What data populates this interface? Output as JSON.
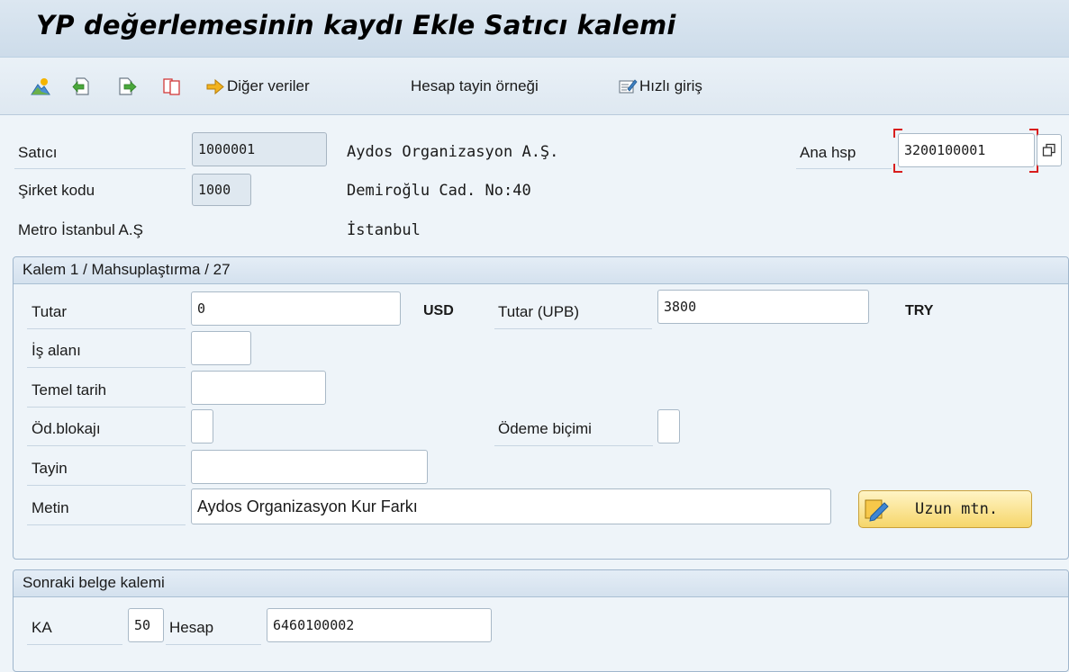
{
  "title": "YP değerlemesinin kaydı Ekle Satıcı kalemi",
  "toolbar": {
    "other_data": "Diğer veriler",
    "account_model": "Hesap tayin örneği",
    "quick_entry": "Hızlı giriş"
  },
  "header": {
    "vendor_label": "Satıcı",
    "vendor_value": "1000001",
    "vendor_name": "Aydos Organizasyon A.Ş.",
    "company_label": "Şirket kodu",
    "company_value": "1000",
    "vendor_street": "Demiroğlu Cad. No:40",
    "company_name": "Metro İstanbul A.Ş",
    "vendor_city": "İstanbul",
    "gl_label": "Ana hsp",
    "gl_value": "3200100001"
  },
  "item": {
    "group_title": "Kalem 1 / Mahsuplaştırma / 27",
    "amount_label": "Tutar",
    "amount_value": "0",
    "amount_currency": "USD",
    "lc_amount_label": "Tutar (UPB)",
    "lc_amount_value": "3800",
    "lc_currency": "TRY",
    "business_area_label": "İş alanı",
    "business_area_value": "",
    "baseline_date_label": "Temel tarih",
    "baseline_date_value": "",
    "payment_block_label": "Öd.blokajı",
    "payment_block_value": "",
    "payment_method_label": "Ödeme biçimi",
    "payment_method_value": "",
    "assignment_label": "Tayin",
    "assignment_value": "",
    "text_label": "Metin",
    "text_value": "Aydos Organizasyon Kur Farkı",
    "long_text_button": "Uzun mtn."
  },
  "next_item": {
    "group_title": "Sonraki belge kalemi",
    "posting_key_label": "KA",
    "posting_key_value": "50",
    "account_label": "Hesap",
    "account_value": "6460100002"
  }
}
